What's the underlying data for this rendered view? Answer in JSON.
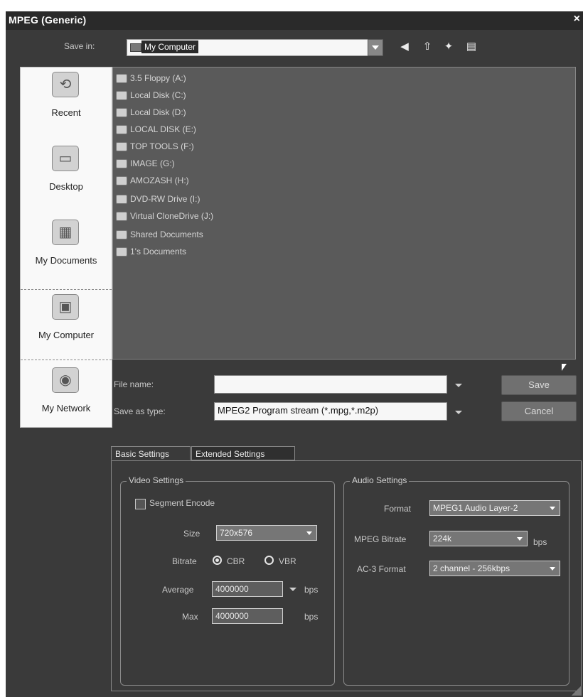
{
  "window": {
    "title": "MPEG (Generic)",
    "close_glyph": "×"
  },
  "save_in": {
    "label": "Save in:",
    "value": "My Computer",
    "icon": "my-computer-icon"
  },
  "toolbar_icons": [
    "back-icon",
    "up-folder-icon",
    "new-folder-icon",
    "view-menu-icon"
  ],
  "places": [
    {
      "label": "Recent",
      "icon": "recent-icon",
      "selected": false
    },
    {
      "label": "Desktop",
      "icon": "desktop-icon",
      "selected": false
    },
    {
      "label": "My Documents",
      "icon": "my-documents-icon",
      "selected": false
    },
    {
      "label": "My Computer",
      "icon": "my-computer-icon",
      "selected": true
    },
    {
      "label": "My Network",
      "icon": "network-icon",
      "selected": false
    }
  ],
  "files": [
    {
      "label": "3.5 Floppy (A:)",
      "icon": "floppy-icon"
    },
    {
      "label": "Local Disk (C:)",
      "icon": "hard-disk-icon"
    },
    {
      "label": "Local Disk (D:)",
      "icon": "hard-disk-icon"
    },
    {
      "label": "LOCAL DISK (E:)",
      "icon": "hard-disk-icon"
    },
    {
      "label": "TOP TOOLS (F:)",
      "icon": "hard-disk-icon"
    },
    {
      "label": "IMAGE (G:)",
      "icon": "hard-disk-icon"
    },
    {
      "label": "AMOZASH (H:)",
      "icon": "hard-disk-icon"
    },
    {
      "label": "DVD-RW Drive (I:)",
      "icon": "dvd-drive-icon"
    },
    {
      "label": "Virtual CloneDrive (J:)",
      "icon": "virtual-drive-icon"
    },
    {
      "label": "Shared Documents",
      "icon": "folder-icon"
    },
    {
      "label": "1's Documents",
      "icon": "folder-icon"
    }
  ],
  "file_name": {
    "label": "File name:",
    "value": ""
  },
  "save_as_type": {
    "label": "Save as type:",
    "value": "MPEG2 Program stream (*.mpg,*.m2p)"
  },
  "buttons": {
    "save": "Save",
    "cancel": "Cancel"
  },
  "tabs": [
    {
      "label": "Basic Settings",
      "active": true
    },
    {
      "label": "Extended Settings",
      "active": false
    }
  ],
  "video": {
    "title": "Video Settings",
    "segment_encode": {
      "label": "Segment Encode",
      "checked": false
    },
    "size_label": "Size",
    "size_value": "720x576",
    "bitrate_label": "Bitrate",
    "cbr_label": "CBR",
    "vbr_label": "VBR",
    "bitrate_mode": "CBR",
    "average_label": "Average",
    "average_value": "4000000",
    "average_unit": "bps",
    "max_label": "Max",
    "max_value": "4000000",
    "max_unit": "bps"
  },
  "audio": {
    "title": "Audio Settings",
    "format_label": "Format",
    "format_value": "MPEG1 Audio Layer-2",
    "mpeg_bitrate_label": "MPEG Bitrate",
    "mpeg_bitrate_value": "224k",
    "mpeg_bitrate_unit": "bps",
    "ac3_label": "AC-3 Format",
    "ac3_value": "2 channel - 256kbps"
  },
  "colors": {
    "window_bg": "#3a3a3a",
    "titlebar_bg": "#2a2a2a",
    "panel_white": "#f9f9f9"
  }
}
